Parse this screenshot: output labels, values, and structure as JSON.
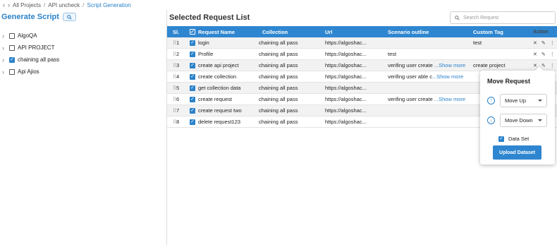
{
  "breadcrumb": {
    "items": [
      "All Projects",
      "API uncheck",
      "Script Generation"
    ]
  },
  "left": {
    "title": "Generate Script",
    "tree": [
      {
        "label": "AlgoQA",
        "checked": false
      },
      {
        "label": "API PROJECT",
        "checked": false
      },
      {
        "label": "chaining all pass",
        "checked": true
      },
      {
        "label": "Api Ajios",
        "checked": false
      }
    ]
  },
  "main": {
    "title": "Selected Request List",
    "search_placeholder": "Search Request",
    "columns": [
      "Sl.",
      "Request Name",
      "Collection",
      "Url",
      "Scenario outline",
      "Custom Tag",
      "Action"
    ],
    "rows": [
      {
        "sl": "1",
        "name": "login",
        "collection": "chaining all pass",
        "url": "https://algoshac...",
        "scenario": "",
        "show_more": "",
        "tag": "test"
      },
      {
        "sl": "2",
        "name": "Profile",
        "collection": "chaining all pass",
        "url": "https://algoshac...",
        "scenario": "test",
        "show_more": "",
        "tag": ""
      },
      {
        "sl": "3",
        "name": "create api project",
        "collection": "chaining all pass",
        "url": "https://algoshac...",
        "scenario": "verifing user create ",
        "show_more": "...Show more",
        "tag": "create project"
      },
      {
        "sl": "4",
        "name": "create collection",
        "collection": "chaining all pass",
        "url": "https://algoshac...",
        "scenario": "verifing user able c",
        "show_more": "...Show more",
        "tag": ""
      },
      {
        "sl": "5",
        "name": "get collection data",
        "collection": "chaining all pass",
        "url": "https://algoshac...",
        "scenario": "",
        "show_more": "",
        "tag": ""
      },
      {
        "sl": "6",
        "name": "create request",
        "collection": "chaining all pass",
        "url": "https://algoshac...",
        "scenario": "verifing user create ",
        "show_more": "...Show more",
        "tag": ""
      },
      {
        "sl": "7",
        "name": "create request two",
        "collection": "chaining all pass",
        "url": "https://algoshac...",
        "scenario": "",
        "show_more": "",
        "tag": ""
      },
      {
        "sl": "8",
        "name": "delete request123",
        "collection": "chaining all pass",
        "url": "https://algoshac...",
        "scenario": "",
        "show_more": "",
        "tag": ""
      }
    ]
  },
  "popover": {
    "title": "Move Request",
    "move_up": "Move Up",
    "move_down": "Move Down",
    "dataset_label": "Data Set",
    "dataset_checked": true,
    "upload_label": "Upload Dataset"
  },
  "colors": {
    "accent": "#2f86d0",
    "link": "#2b82c9"
  }
}
